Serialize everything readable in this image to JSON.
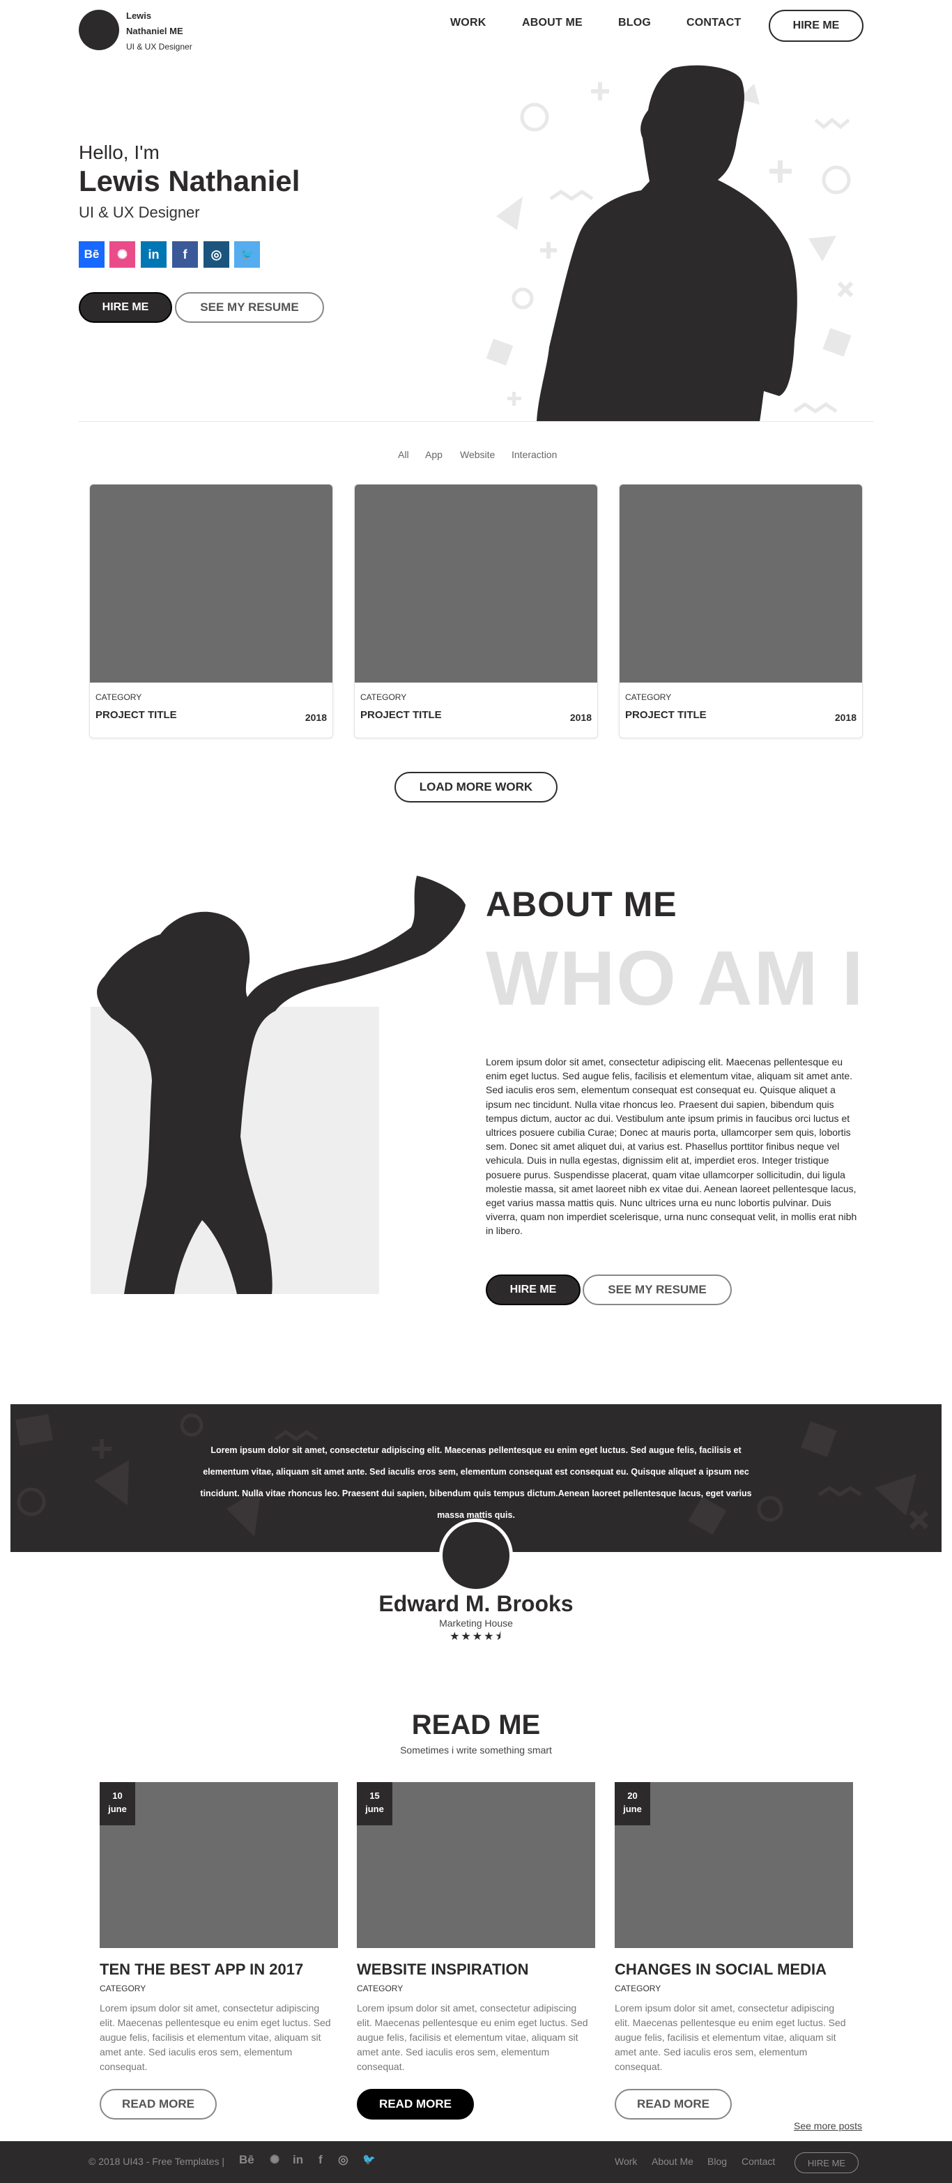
{
  "header": {
    "logo_line1": "Lewis",
    "logo_line2": "Nathaniel ME",
    "logo_sub": "UI & UX Designer",
    "nav": [
      "WORK",
      "ABOUT ME",
      "BLOG",
      "CONTACT"
    ],
    "hire_label": "HIRE ME"
  },
  "hero": {
    "hello": "Hello, I'm",
    "name": "Lewis Nathaniel",
    "role": "UI & UX Designer",
    "socials": [
      {
        "glyph": "Bē",
        "icon": "behance-icon",
        "color": "#1769ff"
      },
      {
        "glyph": "✺",
        "icon": "dribbble-icon",
        "color": "#ea4c89"
      },
      {
        "glyph": "in",
        "icon": "linkedin-icon",
        "color": "#0077b5"
      },
      {
        "glyph": "f",
        "icon": "facebook-icon",
        "color": "#3b5998"
      },
      {
        "glyph": "◎",
        "icon": "instagram-icon",
        "color": "#1b557e"
      },
      {
        "glyph": "🐦",
        "icon": "twitter-icon",
        "color": "#55acee"
      }
    ],
    "hire_label": "HIRE ME",
    "resume_label": "SEE MY RESUME"
  },
  "portfolio": {
    "filters": [
      "All",
      "App",
      "Website",
      "Interaction"
    ],
    "cards": [
      {
        "category": "CATEGORY",
        "title": "PROJECT TITLE",
        "year": "2018"
      },
      {
        "category": "CATEGORY",
        "title": "PROJECT TITLE",
        "year": "2018"
      },
      {
        "category": "CATEGORY",
        "title": "PROJECT TITLE",
        "year": "2018"
      }
    ],
    "load_more_label": "LOAD MORE WORK"
  },
  "about": {
    "title": "ABOUT ME",
    "big_text": "WHO AM I",
    "body": "Lorem ipsum dolor sit amet, consectetur adipiscing elit. Maecenas pellentesque eu enim eget luctus. Sed augue felis, facilisis et elementum vitae, aliquam sit amet ante. Sed iaculis eros sem, elementum consequat est consequat eu. Quisque aliquet a ipsum nec tincidunt. Nulla vitae rhoncus leo. Praesent dui sapien, bibendum quis tempus dictum, auctor ac dui. Vestibulum ante ipsum primis in faucibus orci luctus et ultrices posuere cubilia Curae; Donec at mauris porta, ullamcorper sem quis, lobortis sem. Donec sit amet aliquet dui, at varius est. Phasellus porttitor finibus neque vel vehicula. Duis in nulla egestas, dignissim elit at, imperdiet eros. Integer tristique posuere purus. Suspendisse placerat, quam vitae ullamcorper sollicitudin, dui ligula molestie massa, sit amet laoreet nibh ex vitae dui. Aenean laoreet pellentesque lacus, eget varius massa mattis quis. Nunc ultrices urna eu nunc lobortis pulvinar. Duis viverra, quam non imperdiet scelerisque, urna nunc consequat velit, in mollis erat nibh in libero.",
    "hire_label": "HIRE ME",
    "resume_label": "SEE MY RESUME"
  },
  "testimonial": {
    "quote": "Lorem ipsum dolor sit amet, consectetur adipiscing elit. Maecenas pellentesque eu enim eget luctus. Sed augue felis, facilisis et elementum vitae, aliquam sit amet ante. Sed iaculis eros sem, elementum consequat est consequat eu. Quisque aliquet a ipsum nec tincidunt. Nulla vitae rhoncus leo. Praesent dui sapien, bibendum quis tempus dictum.Aenean laoreet pellentesque lacus, eget varius massa mattis quis.",
    "name": "Edward M. Brooks",
    "company": "Marketing House",
    "rating": 4.5,
    "stars_text": "★★★★⯨"
  },
  "blog": {
    "title": "READ ME",
    "subtitle": "Sometimes i write something smart",
    "posts": [
      {
        "day": "10",
        "month": "june",
        "title": "TEN THE BEST APP IN 2017",
        "category": "CATEGORY",
        "excerpt": "Lorem ipsum dolor sit amet, consectetur adipiscing elit. Maecenas pellentesque eu enim eget luctus. Sed augue felis, facilisis et elementum vitae, aliquam sit amet ante. Sed iaculis eros sem, elementum consequat.",
        "button": "READ MORE"
      },
      {
        "day": "15",
        "month": "june",
        "title": "WEBSITE INSPIRATION",
        "category": "CATEGORY",
        "excerpt": "Lorem ipsum dolor sit amet, consectetur adipiscing elit. Maecenas pellentesque eu enim eget luctus. Sed augue felis, facilisis et elementum vitae, aliquam sit amet ante. Sed iaculis eros sem, elementum consequat.",
        "button": "READ MORE"
      },
      {
        "day": "20",
        "month": "june",
        "title": "CHANGES IN SOCIAL MEDIA",
        "category": "CATEGORY",
        "excerpt": "Lorem ipsum dolor sit amet, consectetur adipiscing elit. Maecenas pellentesque eu enim eget luctus. Sed augue felis, facilisis et elementum vitae, aliquam sit amet ante. Sed iaculis eros sem, elementum consequat.",
        "button": "READ MORE"
      }
    ],
    "see_more": "See more posts"
  },
  "footer": {
    "copyright": "© 2018 UI43 - Free Templates |",
    "icons": [
      {
        "glyph": "Bē",
        "icon": "behance-icon"
      },
      {
        "glyph": "✺",
        "icon": "dribbble-icon"
      },
      {
        "glyph": "in",
        "icon": "linkedin-icon"
      },
      {
        "glyph": "f",
        "icon": "facebook-icon"
      },
      {
        "glyph": "◎",
        "icon": "instagram-icon"
      },
      {
        "glyph": "🐦",
        "icon": "twitter-icon"
      }
    ],
    "nav": [
      "Work",
      "About Me",
      "Blog",
      "Contact"
    ],
    "hire_label": "HIRE ME"
  },
  "colors": {
    "dark": "#2d2a2b",
    "thumb": "#6d6c6d",
    "about_bg": "#eeeeee",
    "big_text": "#e0e0e0"
  }
}
